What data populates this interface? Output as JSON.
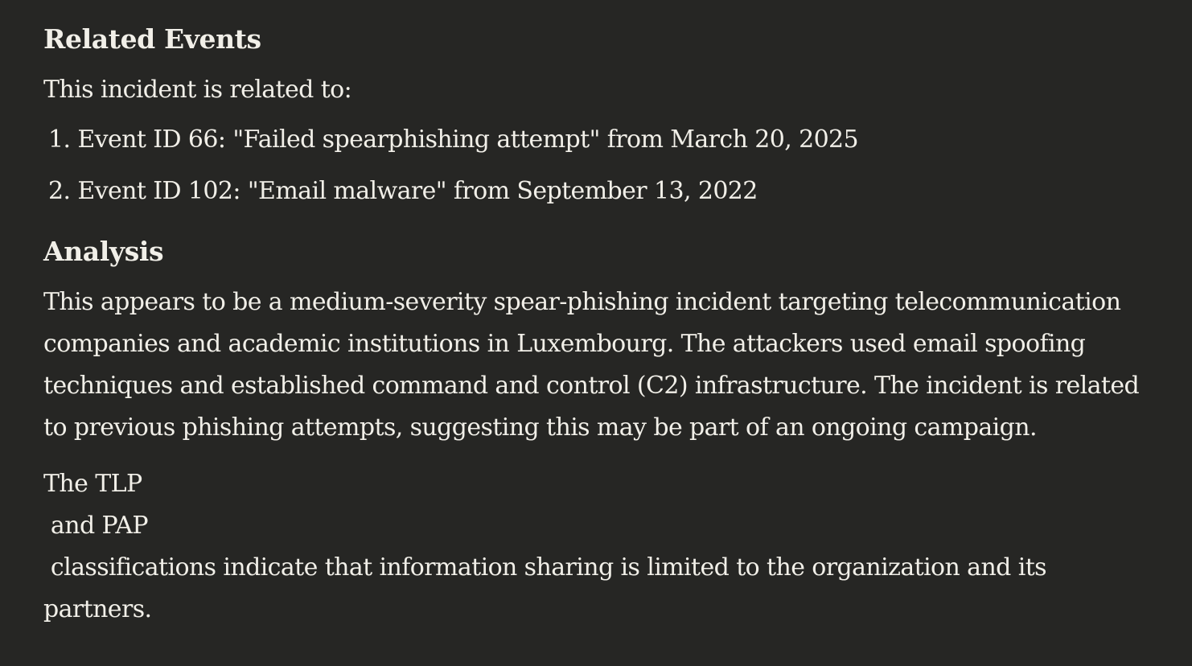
{
  "related": {
    "heading": "Related Events",
    "intro": "This incident is related to:",
    "items": [
      "1. Event ID 66: \"Failed spearphishing attempt\" from March 20, 2025",
      "2. Event ID 102: \"Email malware\" from September 13, 2022"
    ]
  },
  "analysis": {
    "heading": "Analysis",
    "paragraph_lines": [
      "This appears to be a medium-severity spear-phishing incident targeting telecommunication",
      "companies and academic institutions in Luxembourg. The attackers used email spoofing",
      "techniques and established command and control (C2) infrastructure. The incident is related",
      "to previous phishing attempts, suggesting this may be part of an ongoing campaign."
    ],
    "classification_lines": [
      "The TLP",
      " and PAP",
      " classifications indicate that information sharing is limited to the organization and its",
      "partners."
    ]
  }
}
